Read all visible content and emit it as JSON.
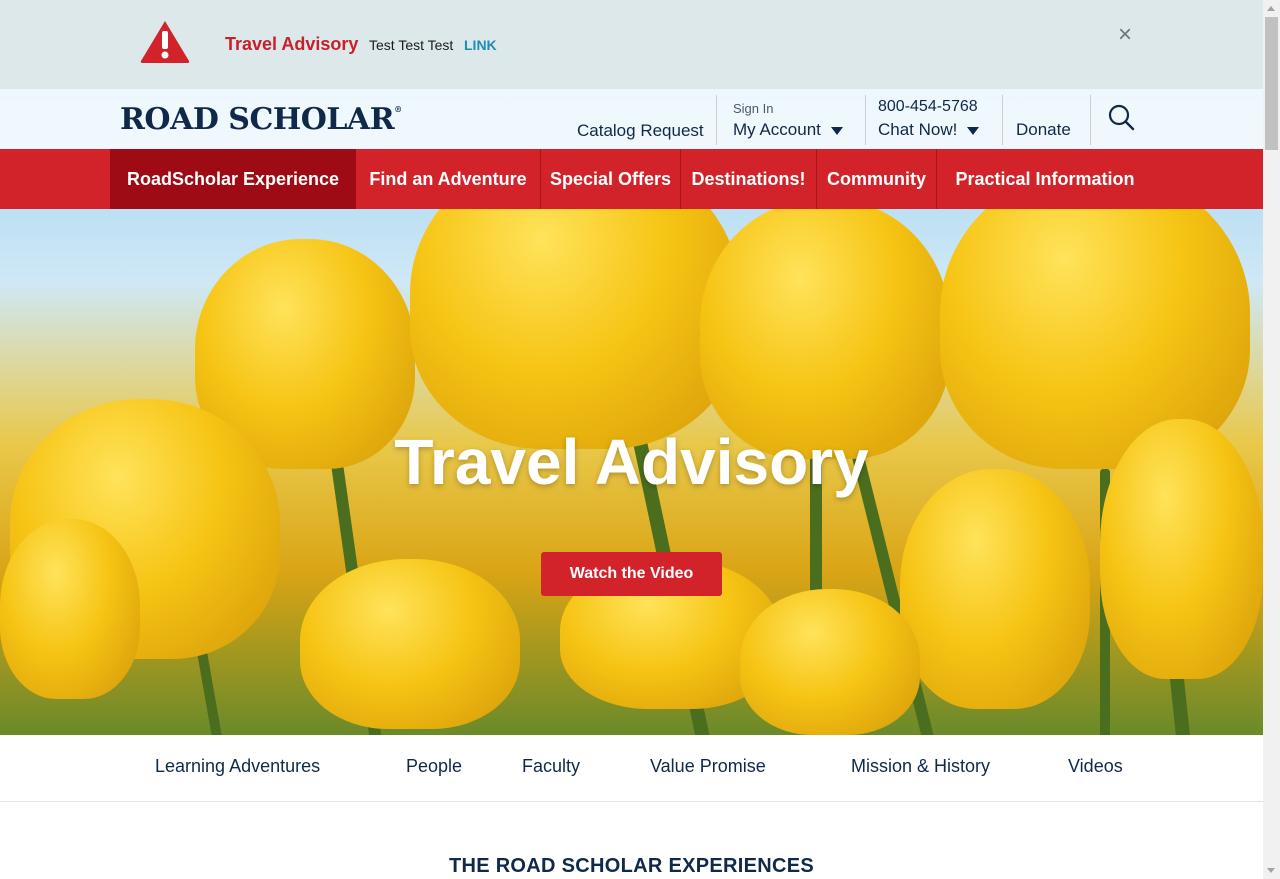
{
  "advisory": {
    "title": "Travel Advisory",
    "text": "Test Test Test",
    "link": "LINK",
    "close_symbol": "×",
    "warning_icon": "warning-triangle-icon"
  },
  "header": {
    "logo": "ROAD SCHOLAR",
    "logo_mark": "®",
    "catalog": "Catalog Request",
    "sign_in": "Sign In",
    "account": "My Account",
    "phone": "800-454-5768",
    "chat": "Chat Now!",
    "donate": "Donate",
    "search_icon": "search-icon"
  },
  "nav": {
    "items": [
      "RoadScholar Experience",
      "Find an Adventure",
      "Special Offers",
      "Destinations!",
      "Community",
      "Practical Information"
    ],
    "active_index": 0
  },
  "hero": {
    "title": "Travel Advisory",
    "button": "Watch the Video"
  },
  "subnav": {
    "items": [
      "Learning Adventures",
      "People",
      "Faculty",
      "Value Promise",
      "Mission & History",
      "Videos"
    ]
  },
  "section": {
    "title": "THE ROAD SCHOLAR EXPERIENCES"
  },
  "colors": {
    "brand_red": "#d2232a",
    "active_red": "#9e0b14",
    "navy": "#10294a",
    "advisory_bg": "#dde8ea",
    "link_blue": "#1f8bb8"
  }
}
